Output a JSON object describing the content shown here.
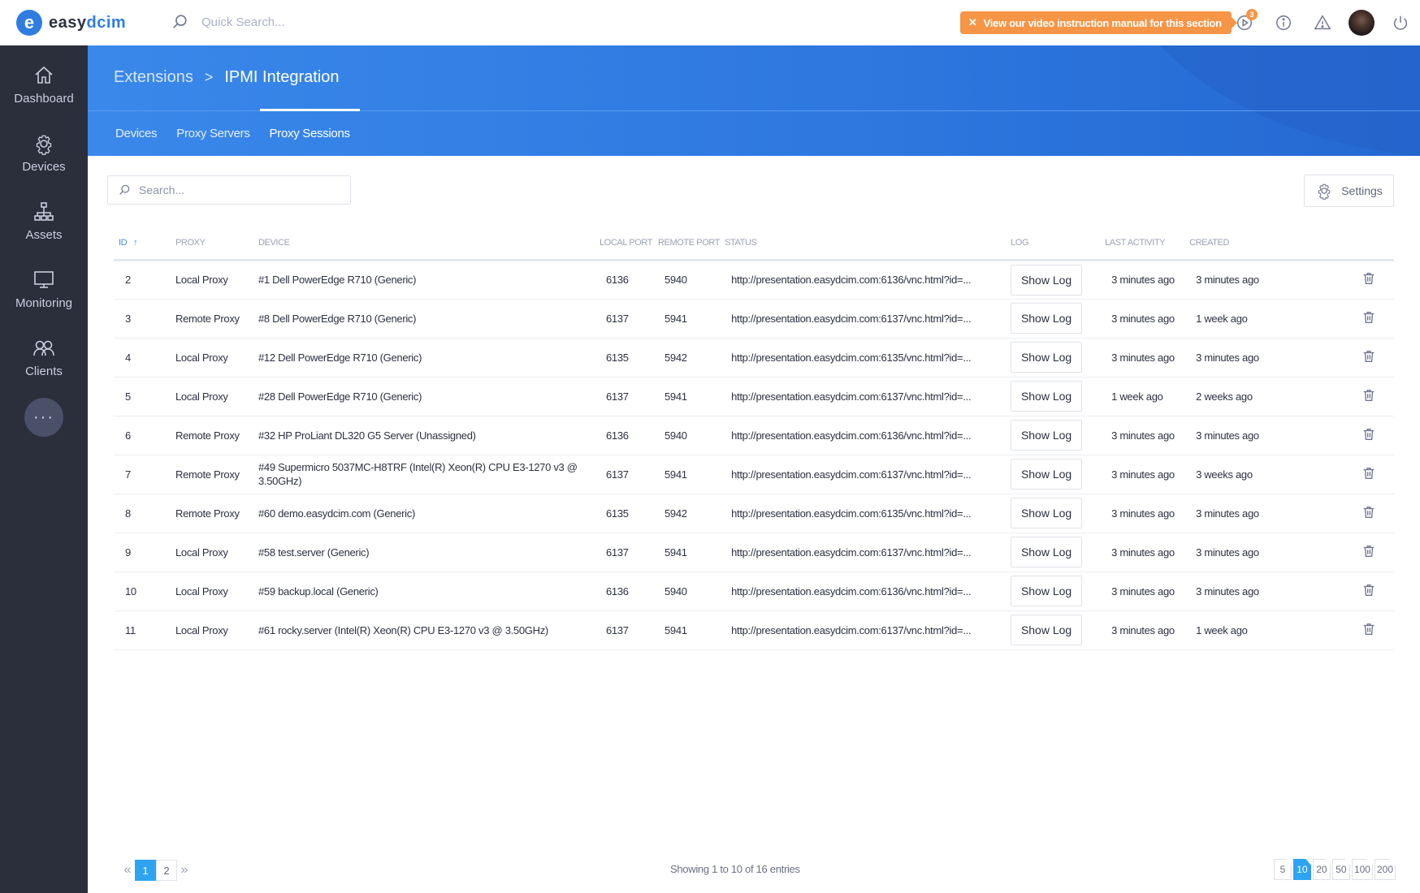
{
  "app": {
    "logo_mark": "e",
    "logo_text_a": "easy",
    "logo_text_b": "dcim"
  },
  "topbar": {
    "search_placeholder": "Quick Search...",
    "video_banner": "View our video instruction manual for this section",
    "video_badge": "3",
    "icons": [
      "video-play-icon",
      "info-icon",
      "warning-icon",
      "avatar",
      "power-icon"
    ]
  },
  "sidebar": {
    "items": [
      {
        "label": "Dashboard",
        "icon": "home-icon"
      },
      {
        "label": "Devices",
        "icon": "gear-icon"
      },
      {
        "label": "Assets",
        "icon": "hierarchy-icon"
      },
      {
        "label": "Monitoring",
        "icon": "monitor-icon"
      },
      {
        "label": "Clients",
        "icon": "users-icon"
      }
    ],
    "more_label": "···"
  },
  "header": {
    "breadcrumb": [
      "Extensions",
      "IPMI Integration"
    ],
    "separator": ">",
    "tabs": [
      {
        "label": "Devices",
        "active": false
      },
      {
        "label": "Proxy Servers",
        "active": false
      },
      {
        "label": "Proxy Sessions",
        "active": true
      }
    ]
  },
  "toolbar": {
    "search_placeholder": "Search...",
    "settings_label": "Settings"
  },
  "table": {
    "columns": [
      "ID",
      "PROXY",
      "DEVICE",
      "LOCAL PORT",
      "REMOTE PORT",
      "STATUS",
      "LOG",
      "LAST ACTIVITY",
      "CREATED",
      ""
    ],
    "sort_indicator": "↑",
    "log_button_label": "Show Log",
    "rows": [
      {
        "id": "2",
        "proxy": "Local Proxy",
        "device": "#1 Dell PowerEdge R710 (Generic)",
        "local_port": "6136",
        "remote_port": "5940",
        "status": "http://presentation.easydcim.com:6136/vnc.html?id=...",
        "last_activity": "3 minutes ago",
        "created": "3 minutes ago"
      },
      {
        "id": "3",
        "proxy": "Remote Proxy",
        "device": "#8 Dell PowerEdge R710 (Generic)",
        "local_port": "6137",
        "remote_port": "5941",
        "status": "http://presentation.easydcim.com:6137/vnc.html?id=...",
        "last_activity": "3 minutes ago",
        "created": "1 week ago"
      },
      {
        "id": "4",
        "proxy": "Local Proxy",
        "device": "#12 Dell PowerEdge R710 (Generic)",
        "local_port": "6135",
        "remote_port": "5942",
        "status": "http://presentation.easydcim.com:6135/vnc.html?id=...",
        "last_activity": "3 minutes ago",
        "created": "3 minutes ago"
      },
      {
        "id": "5",
        "proxy": "Local Proxy",
        "device": "#28 Dell PowerEdge R710 (Generic)",
        "local_port": "6137",
        "remote_port": "5941",
        "status": "http://presentation.easydcim.com:6137/vnc.html?id=...",
        "last_activity": "1 week ago",
        "created": "2 weeks ago"
      },
      {
        "id": "6",
        "proxy": "Remote Proxy",
        "device": "#32 HP ProLiant DL320 G5 Server (Unassigned)",
        "local_port": "6136",
        "remote_port": "5940",
        "status": "http://presentation.easydcim.com:6136/vnc.html?id=...",
        "last_activity": "3 minutes ago",
        "created": "3 minutes ago"
      },
      {
        "id": "7",
        "proxy": "Remote Proxy",
        "device": "#49 Supermicro 5037MC-H8TRF (Intel(R) Xeon(R) CPU E3-1270 v3 @ 3.50GHz)",
        "local_port": "6137",
        "remote_port": "5941",
        "status": "http://presentation.easydcim.com:6137/vnc.html?id=...",
        "last_activity": "3 minutes ago",
        "created": "3 weeks ago"
      },
      {
        "id": "8",
        "proxy": "Remote Proxy",
        "device": "#60 demo.easydcim.com (Generic)",
        "local_port": "6135",
        "remote_port": "5942",
        "status": "http://presentation.easydcim.com:6135/vnc.html?id=...",
        "last_activity": "3 minutes ago",
        "created": "3 minutes ago"
      },
      {
        "id": "9",
        "proxy": "Local Proxy",
        "device": "#58 test.server (Generic)",
        "local_port": "6137",
        "remote_port": "5941",
        "status": "http://presentation.easydcim.com:6137/vnc.html?id=...",
        "last_activity": "3 minutes ago",
        "created": "3 minutes ago"
      },
      {
        "id": "10",
        "proxy": "Local Proxy",
        "device": "#59 backup.local (Generic)",
        "local_port": "6136",
        "remote_port": "5940",
        "status": "http://presentation.easydcim.com:6136/vnc.html?id=...",
        "last_activity": "3 minutes ago",
        "created": "3 minutes ago"
      },
      {
        "id": "11",
        "proxy": "Local Proxy",
        "device": "#61 rocky.server (Intel(R) Xeon(R) CPU E3-1270 v3 @ 3.50GHz)",
        "local_port": "6137",
        "remote_port": "5941",
        "status": "http://presentation.easydcim.com:6137/vnc.html?id=...",
        "last_activity": "3 minutes ago",
        "created": "1 week ago"
      }
    ]
  },
  "pagination": {
    "prev": "«",
    "next": "»",
    "pages": [
      {
        "label": "1",
        "active": true
      },
      {
        "label": "2",
        "active": false
      }
    ],
    "info": "Showing 1 to 10 of 16 entries",
    "per_page": [
      {
        "label": "5",
        "active": false
      },
      {
        "label": "10",
        "active": true
      },
      {
        "label": "20",
        "active": false
      },
      {
        "label": "50",
        "active": false
      },
      {
        "label": "100",
        "active": false
      },
      {
        "label": "200",
        "active": false
      }
    ]
  },
  "colors": {
    "primary": "#2f7de1",
    "sidebar": "#2b2e3b",
    "banner": "#f79547",
    "pager_active": "#2ea3f2"
  }
}
